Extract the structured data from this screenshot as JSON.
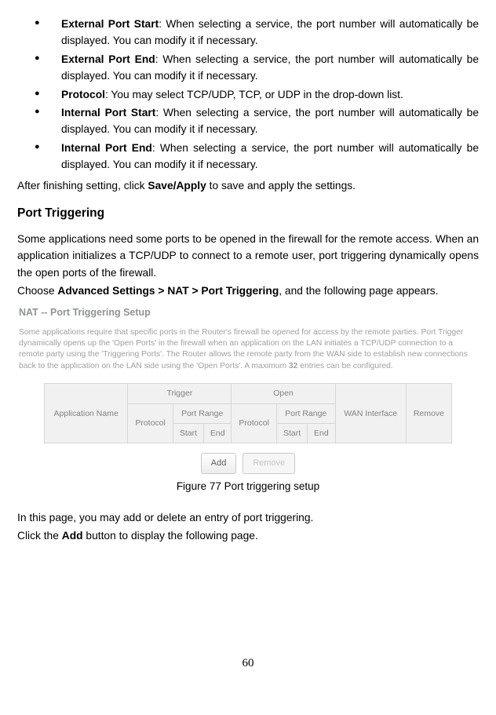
{
  "bullets": [
    {
      "label": "External Port Start",
      "text": ": When selecting a service, the port number will automatically be displayed. You can modify it if necessary."
    },
    {
      "label": "External Port End",
      "text": ": When selecting a service, the port number will automatically be displayed. You can modify it if necessary."
    },
    {
      "label": "Protocol",
      "text": ": You may select TCP/UDP, TCP, or UDP in the drop-down list."
    },
    {
      "label": "Internal Port Start",
      "text": ": When selecting a service, the port number will automatically be displayed. You can modify it if necessary."
    },
    {
      "label": "Internal Port End",
      "text": ": When selecting a service, the port number will automatically be displayed. You can modify it if necessary."
    }
  ],
  "after_note_pre": "After finishing setting, click ",
  "after_note_bold": "Save/Apply",
  "after_note_post": " to save and apply the settings.",
  "section_heading": "Port Triggering",
  "intro_para": "Some applications need some ports to be opened in the firewall for the remote access. When an application initializes a TCP/UDP to connect to a remote user, port triggering dynamically opens the open ports of the firewall.",
  "nav_pre": "Choose ",
  "nav_bold": "Advanced Settings > NAT > Port Triggering",
  "nav_post": ", and the following page appears.",
  "figure": {
    "title": "NAT -- Port Triggering Setup",
    "desc_pre": "Some applications require that specific ports in the Router's firewall be opened for access by the remote parties. Port Trigger dynamically opens up the 'Open Ports' in the firewall when an application on the LAN initiates a TCP/UDP connection to a remote party using the 'Triggering Ports'. The Router allows the remote party from the WAN side to establish new connections back to the application on the LAN side using the 'Open Ports'. A maximum ",
    "desc_max": "32",
    "desc_post": " entries can be configured.",
    "headers": {
      "appname": "Application Name",
      "trigger": "Trigger",
      "open": "Open",
      "wan": "WAN Interface",
      "remove": "Remove",
      "protocol": "Protocol",
      "portrange": "Port Range",
      "start": "Start",
      "end": "End"
    },
    "btn_add": "Add",
    "btn_remove": "Remove"
  },
  "figcaption": "Figure 77 Port triggering setup",
  "post1": "In this page, you may add or delete an entry of port triggering.",
  "post2_pre": "Click the ",
  "post2_bold": "Add",
  "post2_post": " button to display the following page.",
  "pagenum": "60"
}
